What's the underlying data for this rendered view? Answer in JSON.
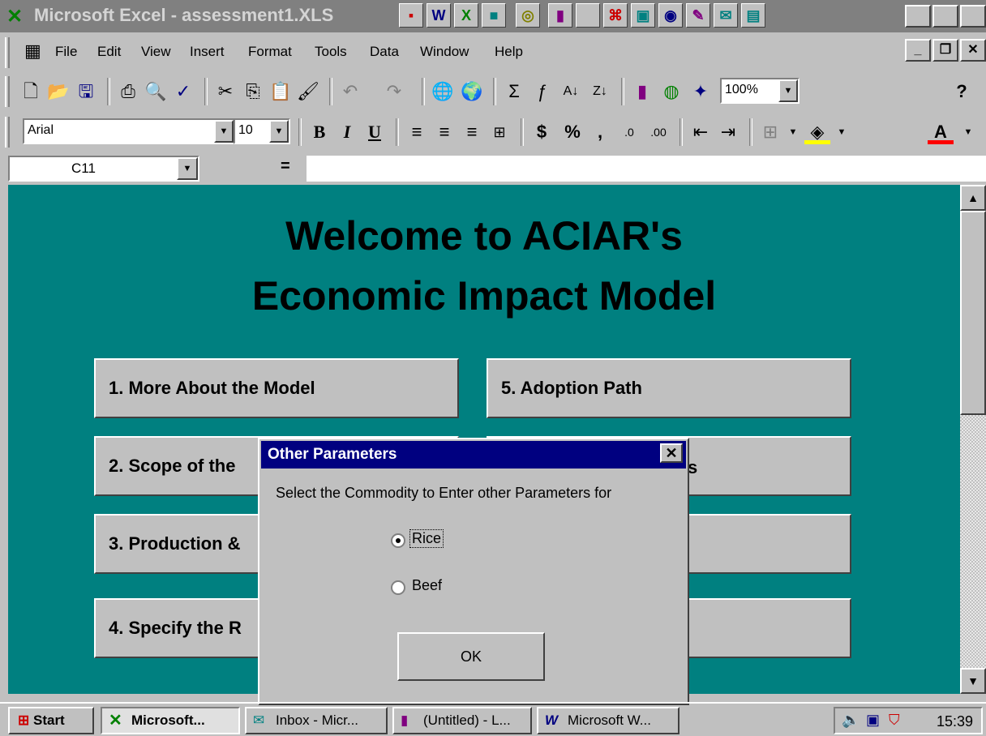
{
  "window": {
    "title": "Microsoft Excel - assessment1.XLS"
  },
  "menubar": {
    "items": [
      "File",
      "Edit",
      "View",
      "Insert",
      "Format",
      "Tools",
      "Data",
      "Window",
      "Help"
    ]
  },
  "toolbar": {
    "zoom": "100%"
  },
  "formatting": {
    "font": "Arial",
    "size": "10",
    "bold": "B",
    "italic": "I",
    "underline": "U",
    "currency": "$",
    "percent": "%",
    "comma": ","
  },
  "formula_bar": {
    "cell_ref": "C11",
    "equals": "="
  },
  "sheet": {
    "heading_line1": "Welcome to ACIAR's",
    "heading_line2": "Economic Impact Model",
    "buttons": [
      "1. More About the Model",
      "2. Scope of the",
      "3. Production &",
      "4. Specify the R",
      "5. Adoption Path",
      "s"
    ]
  },
  "dialog": {
    "title": "Other Parameters",
    "prompt": "Select the Commodity to Enter other Parameters for",
    "options": [
      "Rice",
      "Beef"
    ],
    "selected": "Rice",
    "ok_label": "OK"
  },
  "taskbar": {
    "start": "Start",
    "tasks": [
      "Microsoft...",
      "Inbox - Micr...",
      "(Untitled) - L...",
      "Microsoft W..."
    ],
    "time": "15:39"
  }
}
